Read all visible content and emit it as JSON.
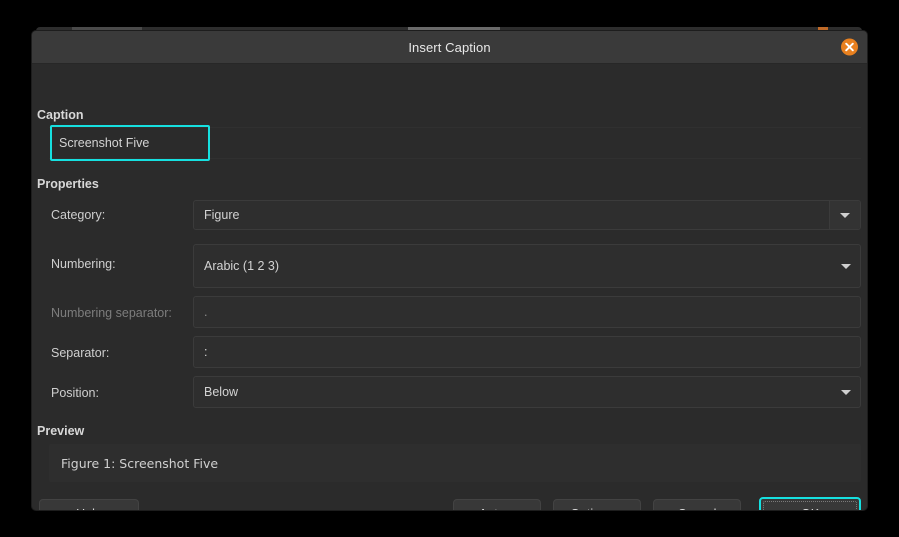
{
  "window": {
    "title": "Insert Caption",
    "close_icon": "close-icon"
  },
  "caption_section": {
    "heading": "Caption",
    "input_value": "Screenshot Five",
    "input_placeholder": ""
  },
  "properties_section": {
    "heading": "Properties",
    "fields": [
      {
        "label": "Category:",
        "value": "Figure",
        "control": "combobox",
        "disabled": false,
        "icon": "chevron-down-icon"
      },
      {
        "label": "Numbering:",
        "value": "Arabic (1 2 3)",
        "control": "dropdown",
        "disabled": false,
        "icon": "chevron-down-icon"
      },
      {
        "label": "Numbering separator:",
        "value": ".",
        "control": "text",
        "disabled": true,
        "icon": ""
      },
      {
        "label": "Separator:",
        "value": ":",
        "control": "text",
        "disabled": false,
        "icon": ""
      },
      {
        "label": "Position:",
        "value": "Below",
        "control": "dropdown",
        "disabled": false,
        "icon": "chevron-down-icon"
      }
    ]
  },
  "preview_section": {
    "heading": "Preview",
    "text": "Figure 1: Screenshot Five"
  },
  "buttons": {
    "help": "Help",
    "auto": "Auto...",
    "options": "Options...",
    "cancel": "Cancel",
    "ok": "OK"
  },
  "colors": {
    "accent_focus": "#16e0e0",
    "close_button": "#e8801f",
    "dialog_bg": "#2b2b2b",
    "titlebar_bg": "#3a3a3a",
    "input_bg": "#2e2e2e",
    "button_bg": "#383838"
  }
}
